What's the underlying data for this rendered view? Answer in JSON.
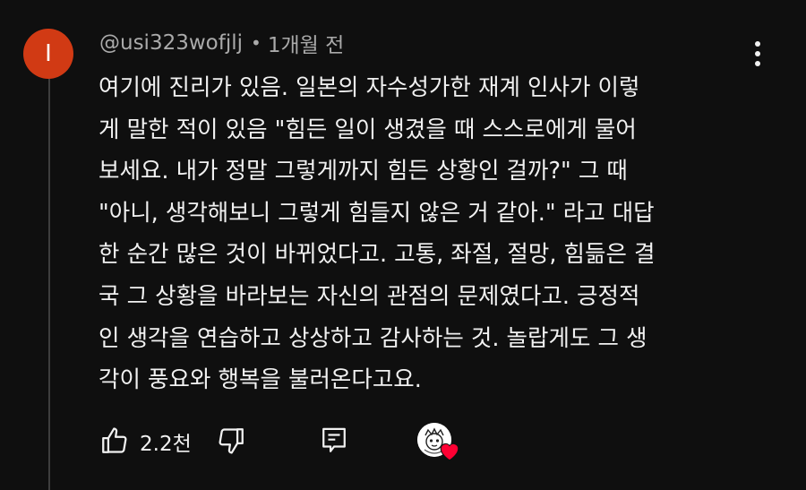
{
  "comment": {
    "avatar_letter": "I",
    "author": "@usi323wofjlj",
    "separator": "•",
    "timestamp": "1개월 전",
    "text_lines": [
      "여기에 진리가 있음. 일본의 자수성가한 재계 인사가 이렇",
      "게 말한 적이 있음 \"힘든 일이 생겼을 때 스스로에게 물어",
      "보세요. 내가 정말 그렇게까지 힘든 상황인 걸까?\" 그 때",
      "\"아니, 생각해보니 그렇게 힘들지 않은 거 같아.\" 라고 대답",
      "한 순간 많은 것이 바뀌었다고. 고통, 좌절, 절망, 힘듦은 결",
      "국 그 상황을 바라보는 자신의 관점의 문제였다고. 긍정적",
      "인 생각을 연습하고 상상하고 감사하는 것. 놀랍게도 그 생",
      "각이 풍요와 행복을 불러온다고요."
    ]
  },
  "actions": {
    "like_count": "2.2천"
  },
  "colors": {
    "background": "#0f0f0f",
    "avatar": "#d13a14",
    "text": "#f1f1f1",
    "secondary_text": "#aaaaaa",
    "heart": "#ff0033"
  },
  "icons": {
    "like": "thumbs-up-icon",
    "dislike": "thumbs-down-icon",
    "reply": "reply-comment-icon",
    "more": "more-vertical-icon",
    "creator_heart": "heart-icon"
  }
}
